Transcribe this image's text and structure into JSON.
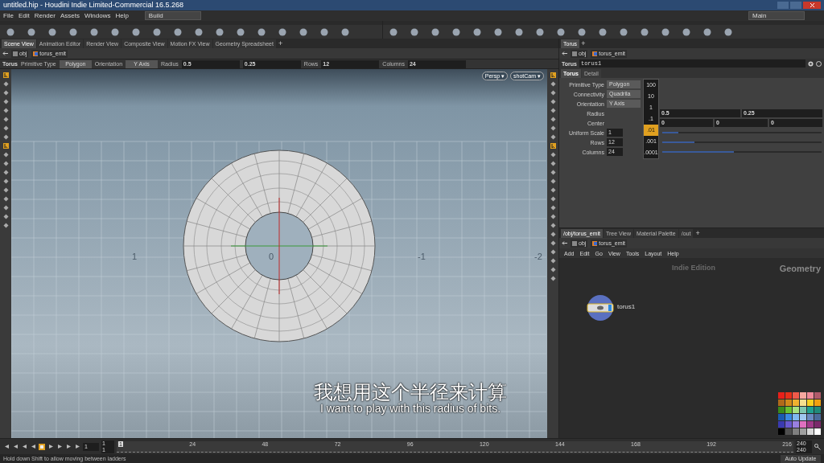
{
  "window": {
    "title": "untitled.hip - Houdini Indie Limited-Commercial 16.5.268"
  },
  "menu": [
    "File",
    "Edit",
    "Render",
    "Assets",
    "Windows",
    "Help"
  ],
  "desktops": [
    {
      "label": "Build"
    },
    {
      "label": "Main"
    }
  ],
  "viewer": {
    "tabs": [
      {
        "label": "Scene View",
        "selected": true
      },
      {
        "label": "Animation Editor",
        "selected": false
      },
      {
        "label": "Render View",
        "selected": false
      },
      {
        "label": "Composite View",
        "selected": false
      },
      {
        "label": "Motion FX View",
        "selected": false
      },
      {
        "label": "Geometry Spreadsheet",
        "selected": false
      }
    ],
    "add_tab": "+",
    "path": [
      "obj",
      "torus_emit"
    ],
    "operator": {
      "node_type": "Torus",
      "fields": [
        {
          "label": "Primitive Type",
          "value": "Polygon",
          "kind": "menu"
        },
        {
          "label": "Orientation",
          "value": "Y Axis",
          "kind": "menu"
        },
        {
          "label": "Radius",
          "value": "0.5",
          "kind": "number"
        },
        {
          "value": "0.25",
          "kind": "number"
        },
        {
          "label": "Rows",
          "value": "12",
          "kind": "number"
        },
        {
          "label": "Columns",
          "value": "24",
          "kind": "number"
        }
      ]
    },
    "camera_menus": [
      "Persp ▾",
      "shotCam ▾"
    ],
    "grid_labels": [
      "1",
      "0",
      "-1",
      "-2"
    ]
  },
  "params": {
    "tab_label": "Torus",
    "add_tab": "+",
    "path": [
      "obj",
      "torus_emit"
    ],
    "node_type": "Torus",
    "node_name": "torus1",
    "tabs": [
      {
        "label": "Torus",
        "selected": true
      },
      {
        "label": "Detail",
        "selected": false
      }
    ],
    "rows": [
      {
        "label": "Primitive Type",
        "kind": "menu",
        "values": [
          "Polygon"
        ]
      },
      {
        "label": "Connectivity",
        "kind": "menu",
        "values": [
          "Quadrila"
        ]
      },
      {
        "label": "Orientation",
        "kind": "menu",
        "values": [
          "Y Axis"
        ]
      },
      {
        "label": "Radius",
        "kind": "vector",
        "values": [
          "0.5",
          "0.25"
        ]
      },
      {
        "label": "Center",
        "kind": "vector",
        "values": [
          "0",
          "0",
          "0"
        ]
      },
      {
        "label": "Uniform Scale",
        "kind": "slider",
        "values": [
          "1"
        ],
        "level": 0.1
      },
      {
        "label": "Rows",
        "kind": "slider",
        "values": [
          "12"
        ],
        "level": 0.2
      },
      {
        "label": "Columns",
        "kind": "slider",
        "values": [
          "24"
        ],
        "level": 0.45
      }
    ],
    "ladder": [
      {
        "label": "100",
        "selected": false
      },
      {
        "label": "10",
        "selected": false
      },
      {
        "label": "1",
        "selected": false
      },
      {
        "label": ".1",
        "selected": false
      },
      {
        "label": ".01",
        "selected": true
      },
      {
        "label": ".001",
        "selected": false
      },
      {
        "label": ".0001",
        "selected": false
      }
    ]
  },
  "network": {
    "tabs": [
      {
        "label": "/obj/torus_emit",
        "selected": true
      },
      {
        "label": "Tree View",
        "selected": false
      },
      {
        "label": "Material Palette",
        "selected": false
      },
      {
        "label": "/out",
        "selected": false
      }
    ],
    "add_tab": "+",
    "path": [
      "obj",
      "torus_emit"
    ],
    "menu": [
      "Add",
      "Edit",
      "Go",
      "View",
      "Tools",
      "Layout",
      "Help"
    ],
    "edition": "Indie Edition",
    "context": "Geometry",
    "node": {
      "name": "torus1"
    },
    "swatches": [
      {
        "color": "#e8201a"
      },
      {
        "color": "#e8301a"
      },
      {
        "color": "#ef5a4a"
      },
      {
        "color": "#f7a8a0"
      },
      {
        "color": "#f08a9a"
      },
      {
        "color": "#b05a6a"
      },
      {
        "color": "#b06a1a"
      },
      {
        "color": "#d08a1a"
      },
      {
        "color": "#f0b030"
      },
      {
        "color": "#f7e090"
      },
      {
        "color": "#f7d020"
      },
      {
        "color": "#f0a010"
      },
      {
        "color": "#3a8a1a"
      },
      {
        "color": "#6ac030"
      },
      {
        "color": "#a8e080"
      },
      {
        "color": "#80c8b0"
      },
      {
        "color": "#20a090"
      },
      {
        "color": "#208a7a"
      },
      {
        "color": "#1a5ab0"
      },
      {
        "color": "#3a8ae0"
      },
      {
        "color": "#80b8f0"
      },
      {
        "color": "#a0c8f0"
      },
      {
        "color": "#6a8ac0"
      },
      {
        "color": "#4a6a9a"
      },
      {
        "color": "#3a3ab0"
      },
      {
        "color": "#6a5ad0"
      },
      {
        "color": "#9a80e0"
      },
      {
        "color": "#e070c0"
      },
      {
        "color": "#a03a8a"
      },
      {
        "color": "#7a2a6a"
      },
      {
        "color": "#000000"
      },
      {
        "color": "#505050"
      },
      {
        "color": "#808080"
      },
      {
        "color": "#a0a0a0"
      },
      {
        "color": "#d8d8d8"
      },
      {
        "color": "#ffffff"
      }
    ]
  },
  "timeline": {
    "current_frame": "1",
    "start": "1",
    "start_2": "1",
    "ticks": [
      "1",
      "24",
      "48",
      "72",
      "96",
      "120",
      "144",
      "168",
      "192",
      "216"
    ],
    "end": "240",
    "end_2": "240"
  },
  "subtitles": {
    "chinese": "我想用这个半径来计算",
    "english": "I want to play with this radius of bits."
  },
  "status_bar": {
    "message": "Hold down Shift to allow moving between ladders",
    "update_mode": "Auto Update"
  }
}
